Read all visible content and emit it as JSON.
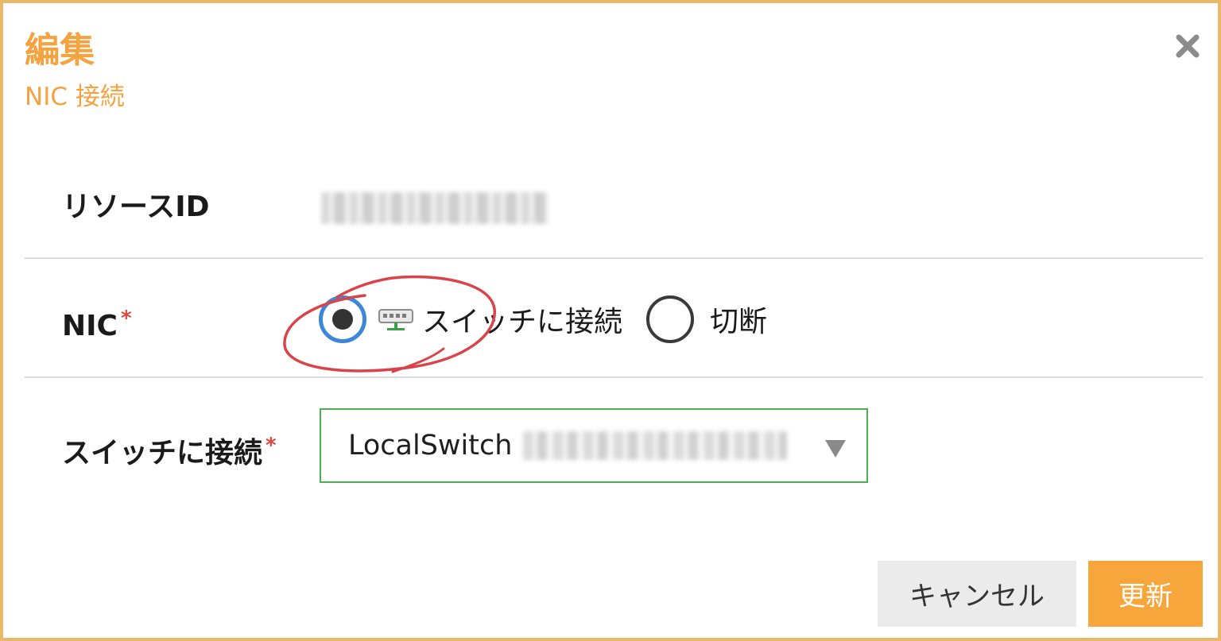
{
  "dialog": {
    "title": "編集",
    "subtitle": "NIC 接続",
    "close_icon": "close-x-icon"
  },
  "form": {
    "resource_id": {
      "label": "リソースID",
      "value": ""
    },
    "nic": {
      "label": "NIC",
      "required_mark": "*",
      "options": [
        {
          "label": "スイッチに接続",
          "selected": true,
          "icon": "switch-icon"
        },
        {
          "label": "切断",
          "selected": false
        }
      ]
    },
    "switch": {
      "label": "スイッチに接続",
      "required_mark": "*",
      "selected_value": "LocalSwitch"
    }
  },
  "buttons": {
    "cancel": "キャンセル",
    "update": "更新"
  },
  "colors": {
    "accent": "#f4a340",
    "frame": "#e9b86a",
    "radio_selected": "#3d87d6",
    "select_border": "#4caf50",
    "annotation": "#d9444b",
    "required": "#e0443e"
  }
}
